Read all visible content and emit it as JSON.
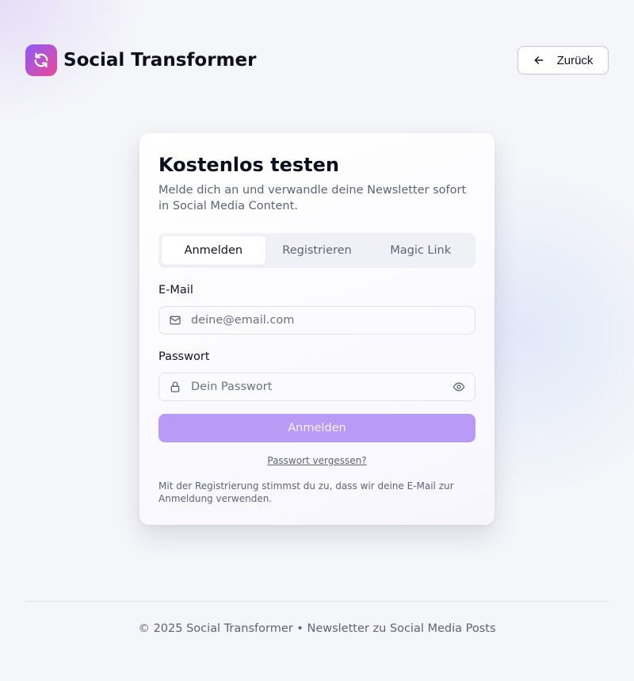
{
  "brand": {
    "name": "Social Transformer",
    "logo_icon": "refresh-icon",
    "gradient": [
      "#8b5cf6",
      "#ec4899"
    ]
  },
  "header": {
    "back_label": "Zurück",
    "back_icon": "arrow-left-icon"
  },
  "card": {
    "title": "Kostenlos testen",
    "subtitle": "Melde dich an und verwandle deine Newsletter sofort in Social Media Content.",
    "tabs": [
      {
        "label": "Anmelden",
        "active": true
      },
      {
        "label": "Registrieren",
        "active": false
      },
      {
        "label": "Magic Link",
        "active": false
      }
    ],
    "email": {
      "label": "E-Mail",
      "placeholder": "deine@email.com",
      "value": "",
      "icon": "mail-icon"
    },
    "password": {
      "label": "Passwort",
      "placeholder": "Dein Passwort",
      "value": "",
      "icon": "lock-icon",
      "toggle_icon": "eye-icon"
    },
    "submit_label": "Anmelden",
    "forgot_label": "Passwort vergessen?",
    "terms": "Mit der Registrierung stimmst du zu, dass wir deine E-Mail zur Anmeldung verwenden."
  },
  "footer": {
    "text": "© 2025 Social Transformer • Newsletter zu Social Media Posts"
  },
  "colors": {
    "accent": "#b99af4",
    "background": "#f5f6fa",
    "muted_text": "#5e6478"
  }
}
